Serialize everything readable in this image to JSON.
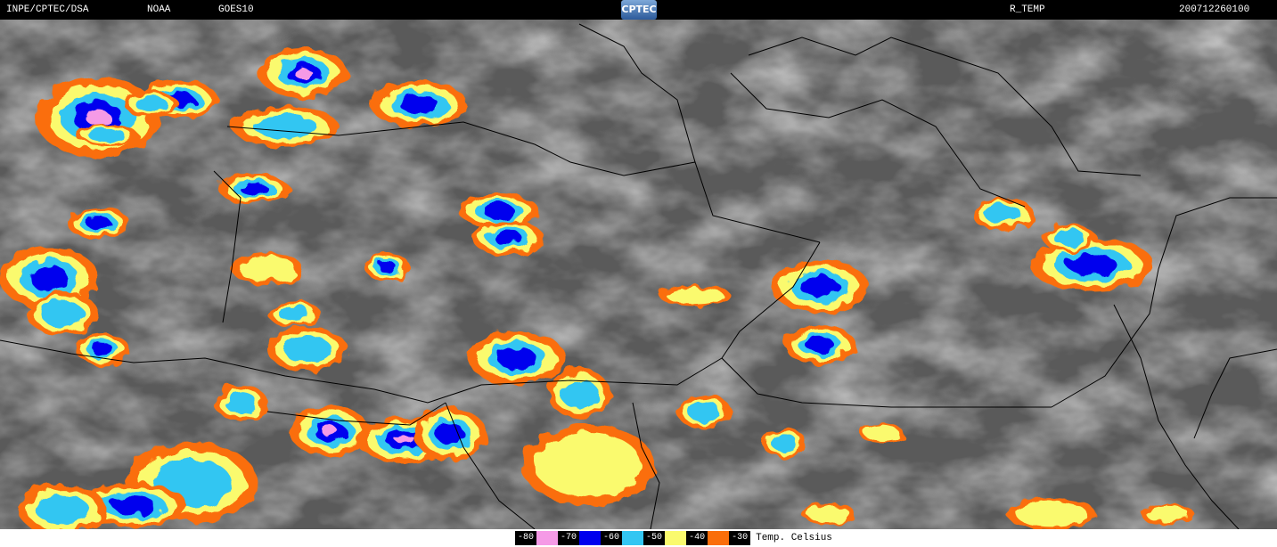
{
  "header": {
    "institution": "INPE/CPTEC/DSA",
    "agency": "NOAA",
    "satellite": "GOES10",
    "logo_text": "CPTEC",
    "product": "R_TEMP",
    "datetime": "200712260100"
  },
  "legend": {
    "unit_label": "Temp. Celsius",
    "items": [
      {
        "label": "-80",
        "color": "#f59ae6"
      },
      {
        "label": "-70",
        "color": "#0000ee"
      },
      {
        "label": "-60",
        "color": "#33c6f2"
      },
      {
        "label": "-50",
        "color": "#fafa6e"
      },
      {
        "label": "-40",
        "color": "#fa6e0a"
      },
      {
        "label": "-30",
        "color": ""
      }
    ]
  },
  "colors": {
    "background_gray": "#5a5a5a",
    "cloud_light": "#c8c8c8",
    "border_line": "#000000"
  }
}
